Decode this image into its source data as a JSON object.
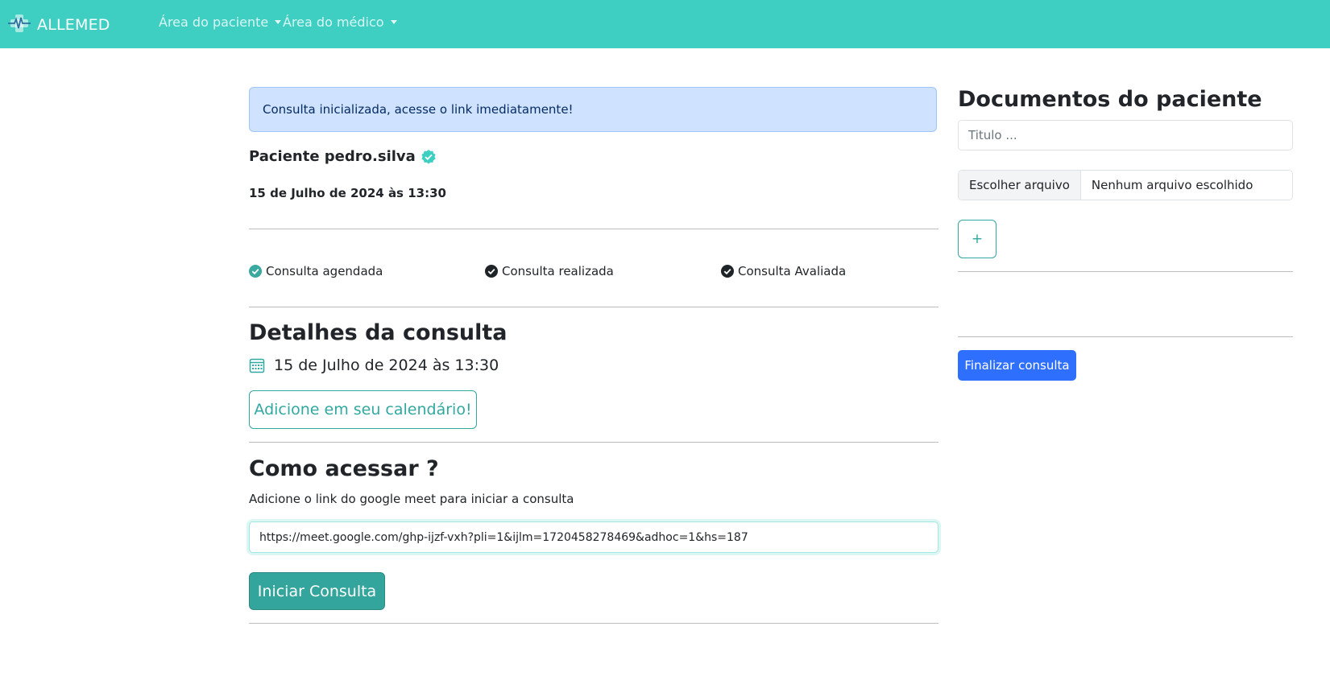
{
  "navbar": {
    "brand": "ALLEMED",
    "menu": [
      {
        "label": "Área do paciente"
      },
      {
        "label": "Área do médico"
      }
    ]
  },
  "alert": {
    "text": "Consulta inicializada, acesse o link imediatamente!"
  },
  "patient": {
    "label": "Paciente pedro.silva",
    "datetime": "15 de Julho de 2024 às 13:30"
  },
  "status": {
    "items": [
      {
        "label": "Consulta agendada",
        "state": "done"
      },
      {
        "label": "Consulta realizada",
        "state": "checked"
      },
      {
        "label": "Consulta Avaliada",
        "state": "checked"
      }
    ]
  },
  "details": {
    "title": "Detalhes da consulta",
    "datetime": "15 de Julho de 2024 às 13:30",
    "calendar_button": "Adicione em seu calendário!"
  },
  "access": {
    "title": "Como acessar ?",
    "subtitle": "Adicione o link do google meet para iniciar a consulta",
    "link_value": "https://meet.google.com/ghp-ijzf-vxh?pli=1&ijlm=1720458278469&adhoc=1&hs=187",
    "start_button": "Iniciar Consulta"
  },
  "documents": {
    "title": "Documentos do paciente",
    "title_placeholder": "Titulo ...",
    "file_button": "Escolher arquivo",
    "file_status": "Nenhum arquivo escolhido",
    "add_button": "+",
    "finish_button": "Finalizar consulta"
  },
  "colors": {
    "navbar": "#3ecfc2",
    "accent": "#31a8a0",
    "primary": "#2f6ffd",
    "alert_bg": "#cfe2ff"
  },
  "icons": [
    "heartbeat-logo-icon",
    "verified-badge-icon",
    "check-circle-icon",
    "calendar-icon",
    "caret-down-icon"
  ]
}
